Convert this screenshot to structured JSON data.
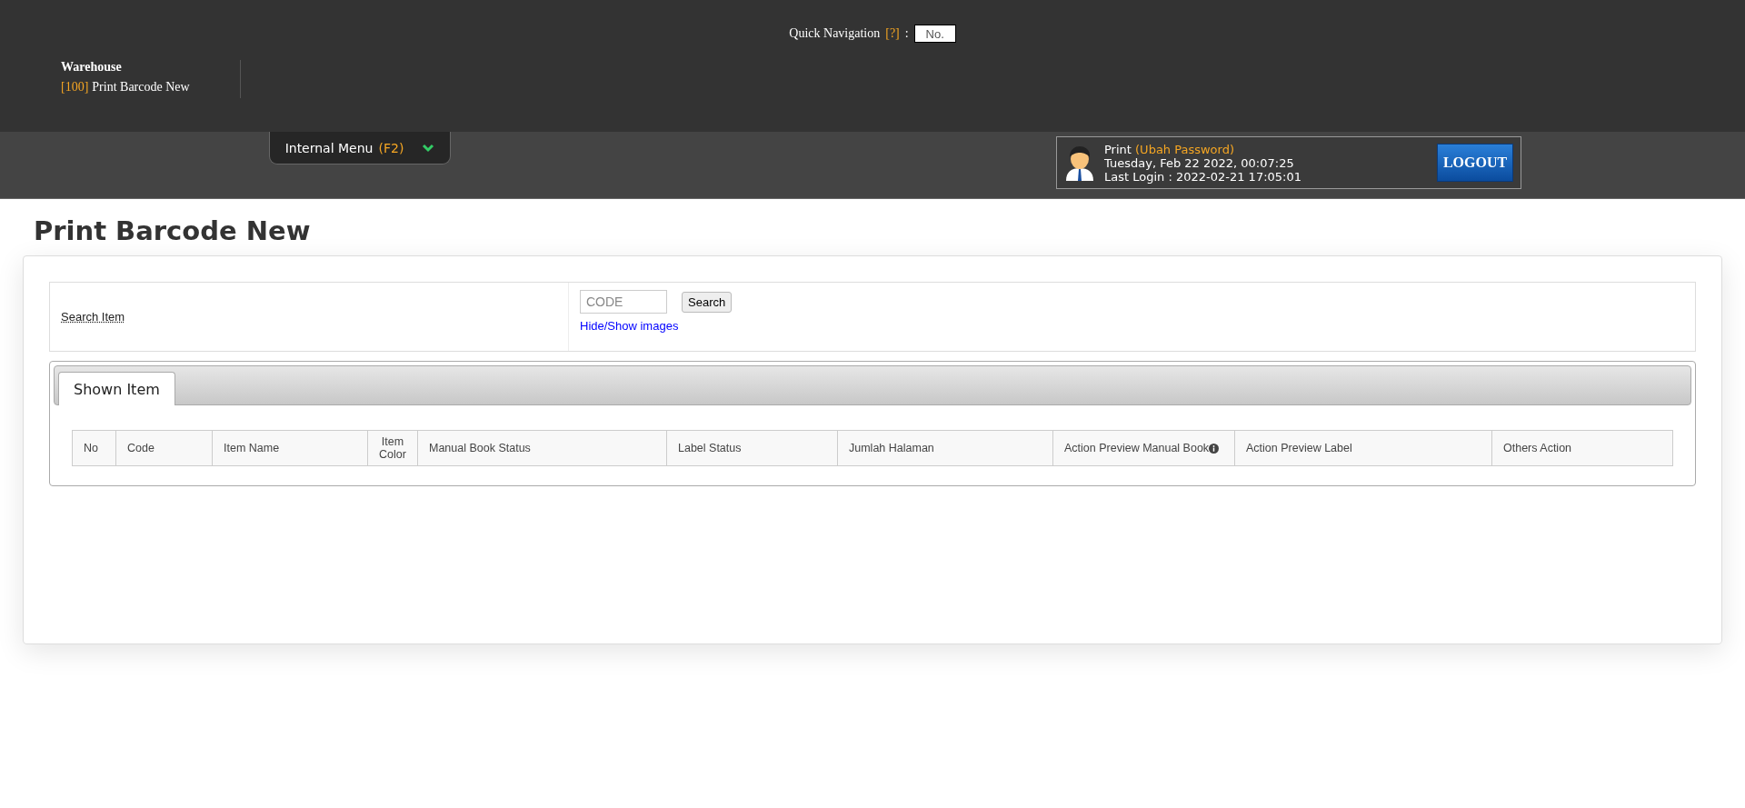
{
  "quick_navigation": {
    "label": "Quick Navigation",
    "help": "[?]",
    "separator": ":",
    "placeholder": "No."
  },
  "breadcrumb": {
    "section": "Warehouse",
    "code": "[100]",
    "page": "Print Barcode New"
  },
  "internal_menu": {
    "label": "Internal Menu",
    "shortcut": "(F2)"
  },
  "user_panel": {
    "name": "Print",
    "change_password": "(Ubah Password)",
    "datetime": "Tuesday, Feb 22 2022, 00:07:25",
    "last_login": "Last Login : 2022-02-21 17:05:01",
    "logout": "LOGOUT"
  },
  "page_title": "Print Barcode New",
  "search": {
    "label": "Search Item",
    "placeholder": "CODE",
    "button": "Search",
    "toggle_link": "Hide/Show images"
  },
  "tabs": [
    {
      "label": "Shown Item",
      "selected": true
    }
  ],
  "table": {
    "columns": [
      {
        "label": "No",
        "info": false
      },
      {
        "label": "Code",
        "info": false
      },
      {
        "label": "Item Name",
        "info": false
      },
      {
        "label": "Item Color",
        "info": false
      },
      {
        "label": "Manual Book Status",
        "info": false
      },
      {
        "label": "Label Status",
        "info": false
      },
      {
        "label": "Jumlah Halaman",
        "info": false
      },
      {
        "label": "Action Preview Manual Book",
        "info": true
      },
      {
        "label": "Action Preview Label",
        "info": false
      },
      {
        "label": "Others Action",
        "info": false
      }
    ]
  }
}
